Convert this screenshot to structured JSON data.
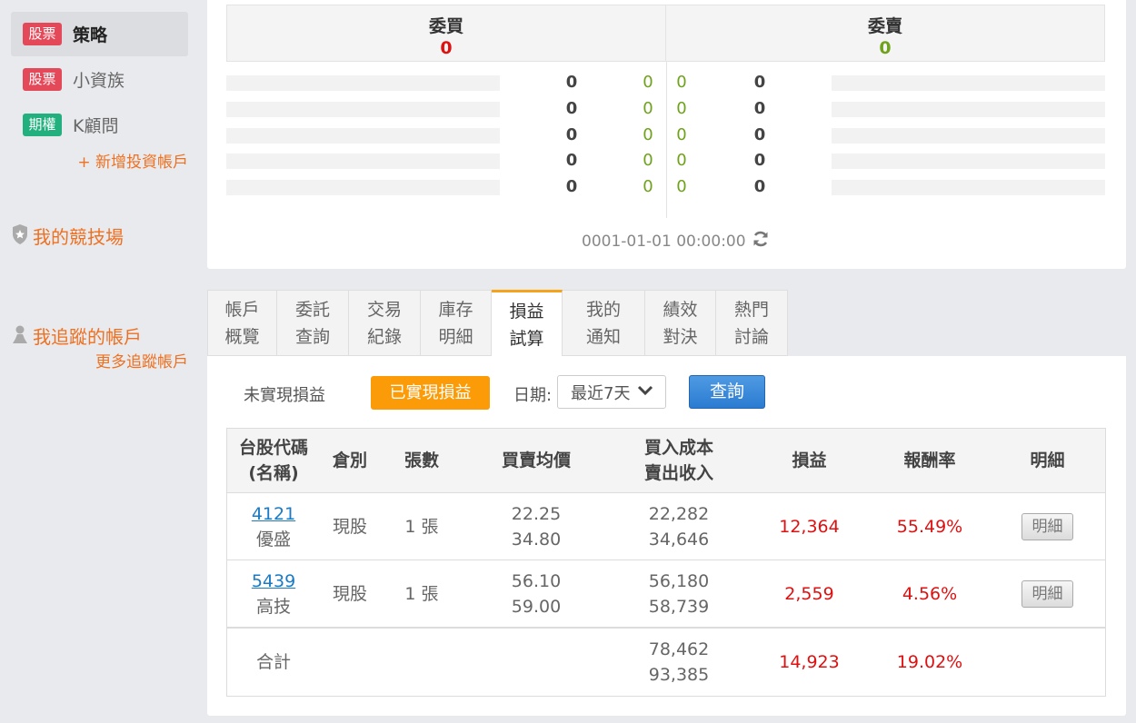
{
  "sidebar": {
    "accounts": [
      {
        "badge": "股票",
        "name": "策略"
      },
      {
        "badge": "股票",
        "name": "小資族"
      },
      {
        "badge": "期權",
        "name": "K顧問"
      }
    ],
    "add_account": "+ 新增投資帳戶",
    "arena": "我的競技場",
    "following": "我追蹤的帳戶",
    "more_following": "更多追蹤帳戶"
  },
  "order_book": {
    "bid_label": "委買",
    "bid_total": "0",
    "ask_label": "委賣",
    "ask_total": "0",
    "rows": [
      {
        "bid_qty": "0",
        "bid_price": "0",
        "ask_price": "0",
        "ask_qty": "0"
      },
      {
        "bid_qty": "0",
        "bid_price": "0",
        "ask_price": "0",
        "ask_qty": "0"
      },
      {
        "bid_qty": "0",
        "bid_price": "0",
        "ask_price": "0",
        "ask_qty": "0"
      },
      {
        "bid_qty": "0",
        "bid_price": "0",
        "ask_price": "0",
        "ask_qty": "0"
      },
      {
        "bid_qty": "0",
        "bid_price": "0",
        "ask_price": "0",
        "ask_qty": "0"
      }
    ],
    "timestamp": "0001-01-01 00:00:00"
  },
  "tabs": [
    {
      "line1": "帳戶",
      "line2": "概覽"
    },
    {
      "line1": "委託",
      "line2": "查詢"
    },
    {
      "line1": "交易",
      "line2": "紀錄"
    },
    {
      "line1": "庫存",
      "line2": "明細"
    },
    {
      "line1": "損益",
      "line2": "試算"
    },
    {
      "line1": "我的",
      "line2": "通知"
    },
    {
      "line1": "績效",
      "line2": "對決"
    },
    {
      "line1": "熱門",
      "line2": "討論"
    }
  ],
  "filters": {
    "unrealized": "未實現損益",
    "realized": "已實現損益",
    "date_label": "日期:",
    "date_value": "最近7天",
    "query": "查詢"
  },
  "table": {
    "headers": {
      "code_line1": "台股代碼",
      "code_line2": "(名稱)",
      "position": "倉別",
      "lots": "張數",
      "avg_line1": "買賣均價",
      "cost_line1": "買入成本",
      "cost_line2": "賣出收入",
      "pl": "損益",
      "roi": "報酬率",
      "detail": "明細"
    },
    "rows": [
      {
        "code": "4121",
        "name": "優盛",
        "position": "現股",
        "lots": "1 張",
        "buy_avg": "22.25",
        "sell_avg": "34.80",
        "cost": "22,282",
        "income": "34,646",
        "pl": "12,364",
        "roi": "55.49%",
        "detail": "明細"
      },
      {
        "code": "5439",
        "name": "高技",
        "position": "現股",
        "lots": "1 張",
        "buy_avg": "56.10",
        "sell_avg": "59.00",
        "cost": "56,180",
        "income": "58,739",
        "pl": "2,559",
        "roi": "4.56%",
        "detail": "明細"
      }
    ],
    "total": {
      "label": "合計",
      "cost": "78,462",
      "income": "93,385",
      "pl": "14,923",
      "roi": "19.02%"
    }
  },
  "colors": {
    "accent_orange": "#fb9b07",
    "link_orange": "#ee7021",
    "stock_badge": "#e4495a",
    "option_badge": "#22b07e",
    "profit_red": "#e01010",
    "zero_green": "#6fa21c",
    "link_blue": "#1a7ac4"
  },
  "icons": {
    "arena": "shield-star-icon",
    "following": "person-icon",
    "refresh": "refresh-icon",
    "select": "chevron-down-icon"
  }
}
